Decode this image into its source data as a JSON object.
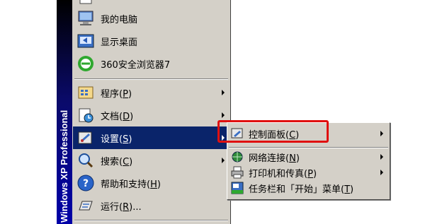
{
  "sidebar": {
    "text": "Windows XP Professional"
  },
  "menu": {
    "items": [
      {
        "label": "我的电脑",
        "icon": "my-computer-icon"
      },
      {
        "label": "显示桌面",
        "icon": "show-desktop-icon"
      },
      {
        "label": "360安全浏览器7",
        "icon": "browser-360-icon"
      },
      {
        "label": "程序",
        "accel": "P",
        "icon": "programs-icon"
      },
      {
        "label": "文档",
        "accel": "D",
        "icon": "documents-icon"
      },
      {
        "label": "设置",
        "accel": "S",
        "icon": "settings-icon"
      },
      {
        "label": "搜索",
        "accel": "C",
        "icon": "search-icon"
      },
      {
        "label": "帮助和支持",
        "accel": "H",
        "icon": "help-icon"
      },
      {
        "label": "运行",
        "accel": "R",
        "suffix": "...",
        "icon": "run-icon"
      }
    ]
  },
  "submenu": {
    "items": [
      {
        "label": "控制面板",
        "accel": "C",
        "icon": "control-panel-icon"
      },
      {
        "label": "网络连接",
        "accel": "N",
        "icon": "network-icon"
      },
      {
        "label": "打印机和传真",
        "accel": "P",
        "icon": "printer-icon"
      },
      {
        "label": "任务栏和「开始」菜单",
        "accel": "T",
        "icon": "taskbar-icon"
      }
    ]
  },
  "colors": {
    "menu_bg": "#d4d0c8",
    "selection": "#0a246a",
    "highlight": "#e01010"
  }
}
